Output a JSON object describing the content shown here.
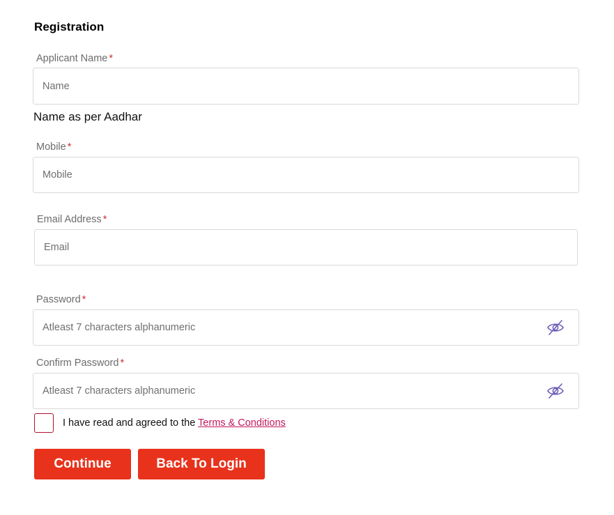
{
  "form": {
    "title": "Registration",
    "required_mark": "*",
    "applicant_name": {
      "label": "Applicant Name",
      "placeholder": "Name",
      "value": "",
      "hint": "Name as per Aadhar"
    },
    "mobile": {
      "label": "Mobile",
      "placeholder": "Mobile",
      "value": ""
    },
    "email": {
      "label": "Email Address",
      "placeholder": "Email",
      "value": ""
    },
    "password": {
      "label": "Password",
      "placeholder": "Atleast 7 characters alphanumeric",
      "value": "",
      "toggle_icon": "eye-slash-icon"
    },
    "confirm_password": {
      "label": "Confirm Password",
      "placeholder": "Atleast 7 characters alphanumeric",
      "value": "",
      "toggle_icon": "eye-slash-icon"
    },
    "terms": {
      "checked": false,
      "text": "I have read and agreed to the",
      "link_text": "Terms & Conditions"
    },
    "buttons": {
      "continue_label": "Continue",
      "back_label": "Back To Login"
    }
  },
  "colors": {
    "primary_button": "#e8321c",
    "required": "#d32f2f",
    "link": "#c2185b",
    "checkbox_border": "#b2102f",
    "eye_icon": "#6a5fb8"
  }
}
